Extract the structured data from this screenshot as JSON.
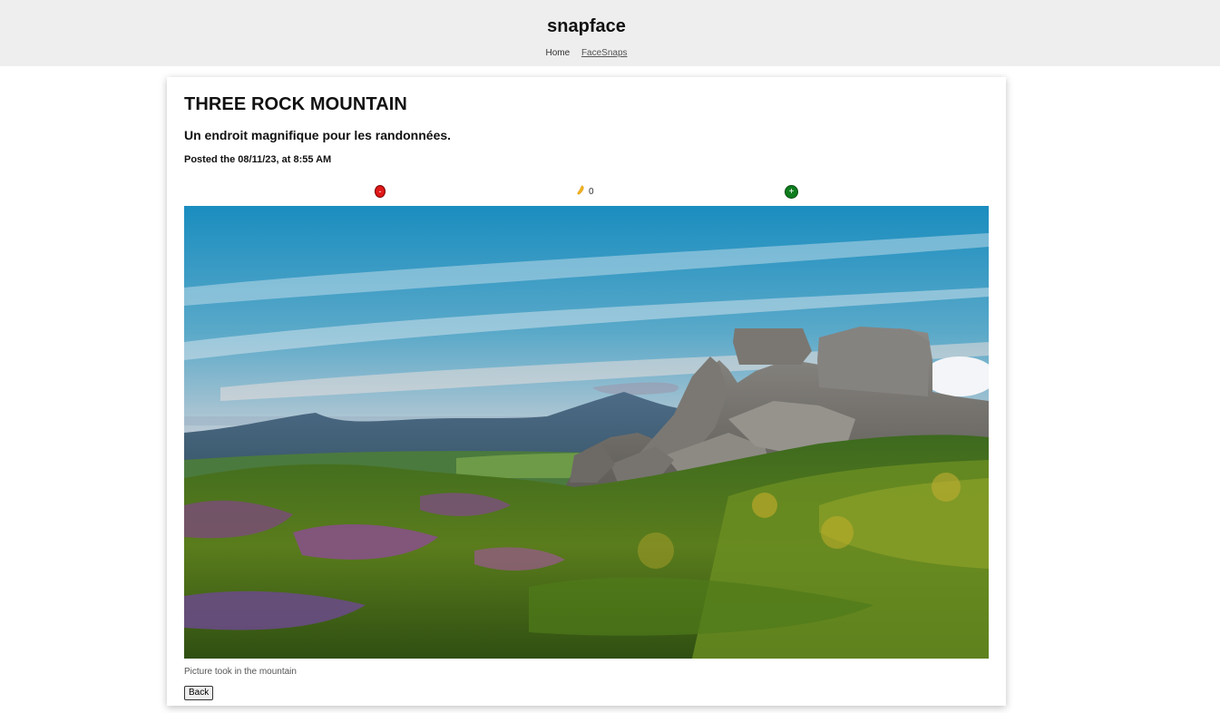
{
  "header": {
    "brand": "snapface",
    "nav": [
      {
        "label": "Home"
      },
      {
        "label": "FaceSnaps"
      }
    ]
  },
  "facesnap": {
    "title": "THREE ROCK MOUNTAIN",
    "description": "Un endroit magnifique pour les randonnées.",
    "posted": "Posted the 08/11/23, at 8:55 AM",
    "snaps": "0",
    "minus_label": "-",
    "plus_label": "+",
    "image_caption": "Picture took in the mountain",
    "back_label": "Back"
  },
  "colors": {
    "minus_button": "#e01818",
    "plus_button": "#0e7d1e",
    "snap_icon": "#f2b21d",
    "header_bg": "#eeeeee"
  },
  "icons": {
    "snap": "snap-fingers-icon"
  }
}
